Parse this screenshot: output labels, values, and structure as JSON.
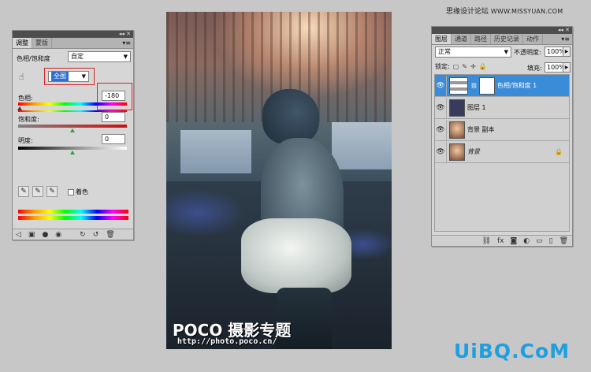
{
  "watermark": {
    "top_text": "思缘设计论坛",
    "top_site": "WWW.MISSYUAN.COM",
    "bottom_text": "UiBQ.CoM"
  },
  "adjustments_panel": {
    "collapse_glyph": "◂◂ ✕",
    "tabs": [
      {
        "label": "调整",
        "active": true
      },
      {
        "label": "蒙版",
        "active": false
      }
    ],
    "menu_glyph": "▾≡",
    "preset_label": "色相/饱和度",
    "preset_value": "自定",
    "channel_value": "全图",
    "hue": {
      "label": "色相:",
      "value": "-180",
      "slider_fraction": 0.0
    },
    "saturation": {
      "label": "饱和度:",
      "value": "0",
      "slider_fraction": 0.5
    },
    "lightness": {
      "label": "明度:",
      "value": "0",
      "slider_fraction": 0.5
    },
    "colorize_label": "着色",
    "colorize_checked": false
  },
  "photo": {
    "brand": "POCO 摄影专题",
    "url": "http://photo.poco.cn/"
  },
  "layers_panel": {
    "collapse_glyph": "◂◂ ✕",
    "tabs": [
      {
        "label": "图层",
        "active": true
      },
      {
        "label": "通道",
        "active": false
      },
      {
        "label": "路径",
        "active": false
      },
      {
        "label": "历史记录",
        "active": false
      },
      {
        "label": "动作",
        "active": false
      }
    ],
    "menu_glyph": "▾≡",
    "blend_mode": "正常",
    "opacity_label": "不透明度:",
    "opacity_value": "100%",
    "lock_label": "锁定:",
    "fill_label": "填充:",
    "fill_value": "100%",
    "layers": [
      {
        "name": "色相/饱和度 1",
        "selected": true,
        "italic": false,
        "thumb": "adjustment",
        "locked": false
      },
      {
        "name": "图层 1",
        "selected": false,
        "italic": false,
        "thumb": "purple",
        "locked": false
      },
      {
        "name": "背景 副本",
        "selected": false,
        "italic": false,
        "thumb": "photo",
        "locked": false
      },
      {
        "name": "背景",
        "selected": false,
        "italic": true,
        "thumb": "photo",
        "locked": true
      }
    ]
  },
  "colors": {
    "selection_blue": "#3a8bd8",
    "highlight_red": "#d52525",
    "layer1_fill": "#3a3a5c",
    "watermark_blue": "#1d9fe0"
  }
}
